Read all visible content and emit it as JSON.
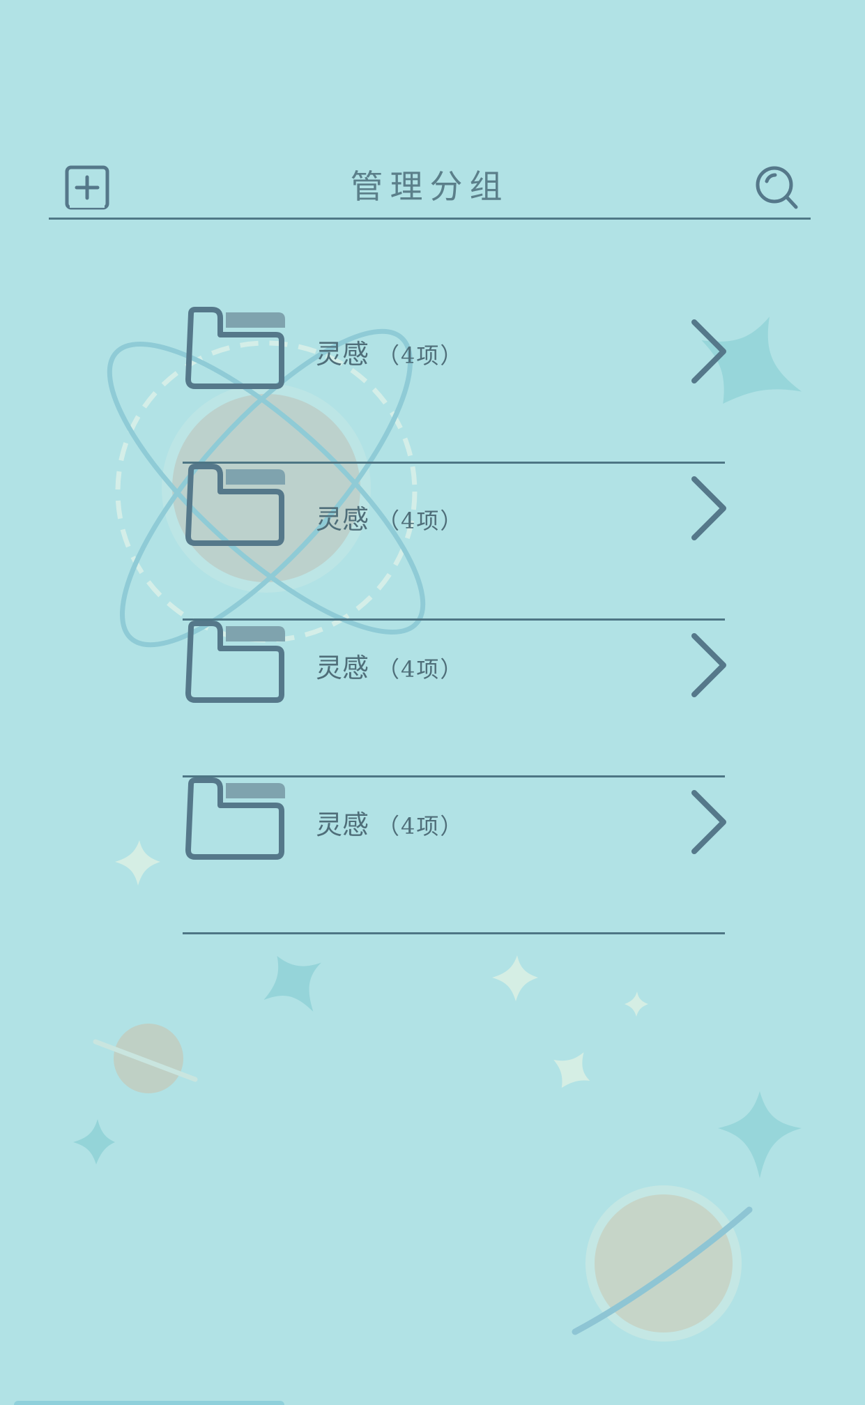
{
  "header": {
    "title": "管理分组",
    "add_icon": "add-square-icon",
    "search_icon": "search-icon",
    "line_color": "#4f7886"
  },
  "groups": [
    {
      "name": "灵感",
      "count_text": "（4项）",
      "icon": "folder-icon"
    },
    {
      "name": "灵感",
      "count_text": "（4项）",
      "icon": "folder-icon"
    },
    {
      "name": "灵感",
      "count_text": "（4项）",
      "icon": "folder-icon"
    },
    {
      "name": "灵感",
      "count_text": "（4项）",
      "icon": "folder-icon"
    }
  ],
  "colors": {
    "background": "#b1e2e5",
    "icon_stroke": "#55788a",
    "text": "#4f6e79"
  }
}
